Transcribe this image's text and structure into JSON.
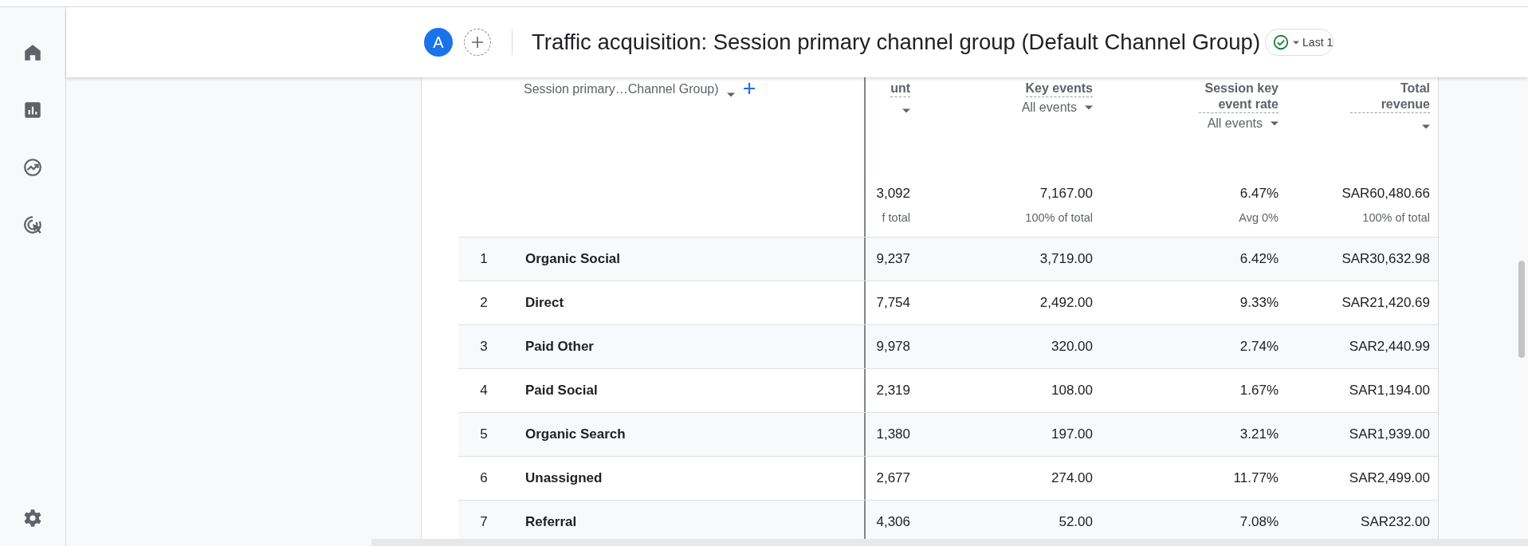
{
  "header": {
    "avatar": "A",
    "title": "Traffic acquisition: Session primary channel group (Default Channel Group)",
    "status_checked": true,
    "date_range": "Last 1"
  },
  "table": {
    "dimension": "Session primary…Channel Group)",
    "columns": [
      {
        "label": "unt"
      },
      {
        "label": "Key events",
        "filter": "All events"
      },
      {
        "label": "Session key event rate",
        "filter": "All events"
      },
      {
        "label": "Total revenue"
      }
    ],
    "totals": [
      "3,092",
      "7,167.00",
      "6.47%",
      "SAR60,480.66"
    ],
    "totals_note": [
      "f total",
      "100% of total",
      "Avg 0%",
      "100% of total"
    ],
    "rows": [
      {
        "rank": "1",
        "name": "Organic Social",
        "values": [
          "9,237",
          "3,719.00",
          "6.42%",
          "SAR30,632.98"
        ]
      },
      {
        "rank": "2",
        "name": "Direct",
        "values": [
          "7,754",
          "2,492.00",
          "9.33%",
          "SAR21,420.69"
        ]
      },
      {
        "rank": "3",
        "name": "Paid Other",
        "values": [
          "9,978",
          "320.00",
          "2.74%",
          "SAR2,440.99"
        ]
      },
      {
        "rank": "4",
        "name": "Paid Social",
        "values": [
          "2,319",
          "108.00",
          "1.67%",
          "SAR1,194.00"
        ]
      },
      {
        "rank": "5",
        "name": "Organic Search",
        "values": [
          "1,380",
          "197.00",
          "3.21%",
          "SAR1,939.00"
        ]
      },
      {
        "rank": "6",
        "name": "Unassigned",
        "values": [
          "2,677",
          "274.00",
          "11.77%",
          "SAR2,499.00"
        ]
      },
      {
        "rank": "7",
        "name": "Referral",
        "values": [
          "4,306",
          "52.00",
          "7.08%",
          "SAR232.00"
        ]
      }
    ]
  }
}
